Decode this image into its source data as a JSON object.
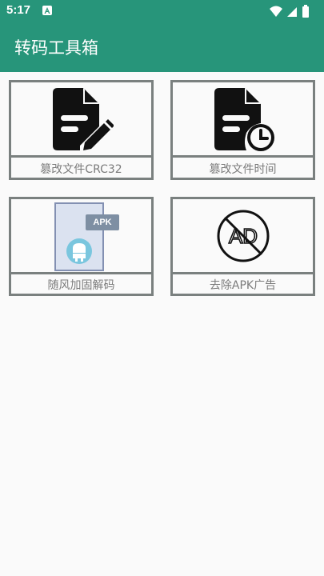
{
  "status_bar": {
    "time": "5:17",
    "icons": [
      "notification-icon",
      "wifi-icon",
      "signal-icon",
      "battery-icon"
    ]
  },
  "app_bar": {
    "title": "转码工具箱",
    "color": "#27957a"
  },
  "tools": [
    {
      "label": "篡改文件CRC32",
      "icon": "edit-file-icon"
    },
    {
      "label": "篡改文件时间",
      "icon": "file-time-icon"
    },
    {
      "label": "随风加固解码",
      "icon": "apk-file-icon",
      "badge": "APK"
    },
    {
      "label": "去除APK广告",
      "icon": "no-ad-icon"
    }
  ]
}
